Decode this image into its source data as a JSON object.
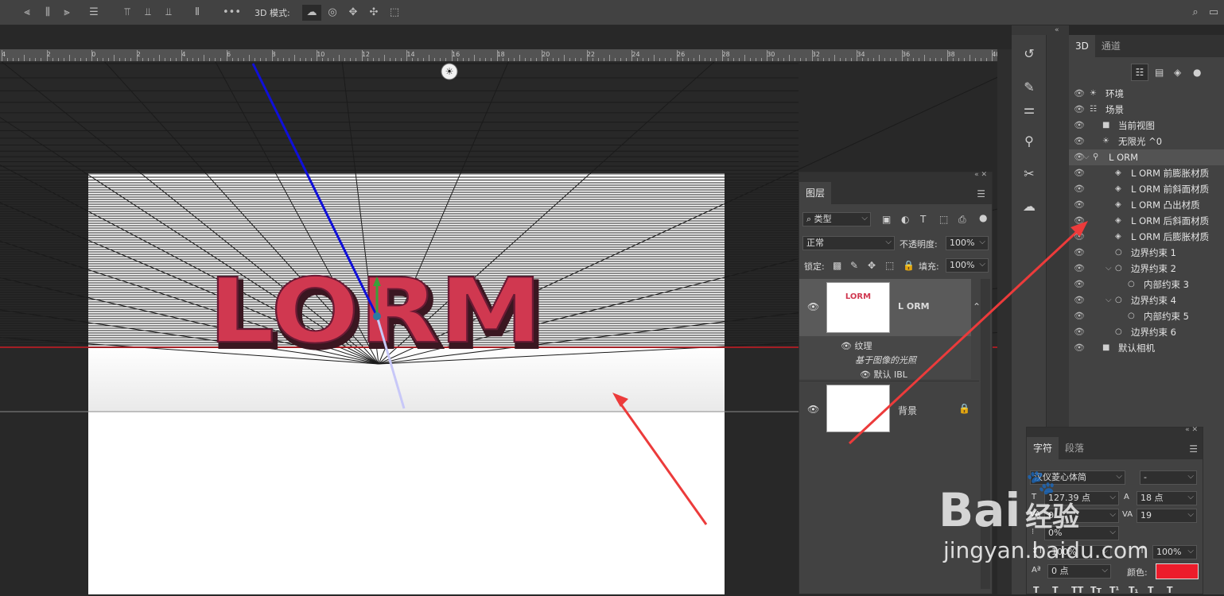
{
  "optionsbar": {
    "mode3d_label": "3D 模式:"
  },
  "ruler": {
    "labels": [
      "4",
      "2",
      "0",
      "2",
      "4",
      "6",
      "8",
      "10",
      "12",
      "14",
      "16",
      "18",
      "20",
      "22",
      "24",
      "26",
      "28",
      "30",
      "32",
      "34",
      "36",
      "38",
      "40"
    ]
  },
  "canvas": {
    "text3d": "LORM"
  },
  "panel3d": {
    "tabs": [
      "3D",
      "通道"
    ],
    "rows": [
      {
        "label": "环境"
      },
      {
        "label": "场景"
      },
      {
        "label": "当前视图"
      },
      {
        "label": "无限光 ^0"
      },
      {
        "label": "L ORM"
      },
      {
        "label": "L ORM 前膨胀材质"
      },
      {
        "label": "L ORM 前斜面材质"
      },
      {
        "label": "L ORM 凸出材质"
      },
      {
        "label": "L ORM 后斜面材质"
      },
      {
        "label": "L ORM 后膨胀材质"
      },
      {
        "label": "边界约束 1"
      },
      {
        "label": "边界约束 2"
      },
      {
        "label": "内部约束 3"
      },
      {
        "label": "边界约束 4"
      },
      {
        "label": "内部约束 5"
      },
      {
        "label": "边界约束 6"
      },
      {
        "label": "默认相机"
      }
    ]
  },
  "layers": {
    "tab": "图层",
    "filter": "类型",
    "blend": "正常",
    "opacity_label": "不透明度:",
    "opacity": "100%",
    "lock_label": "锁定:",
    "fill_label": "填充:",
    "fill": "100%",
    "layer1_name": "L ORM",
    "thumb_text": "LORM",
    "texture_label": "纹理",
    "ibl_label": "基于图像的光照",
    "default_ibl": "默认 IBL",
    "bg_name": "背景"
  },
  "character": {
    "tabs": [
      "字符",
      "段落"
    ],
    "font": "汉仪菱心体简",
    "style": "-",
    "size": "127.39 点",
    "leading": "18 点",
    "kerning": "0",
    "tracking": "19",
    "vscale_pct": "0%",
    "hscale": "100%",
    "vscale": "100%",
    "baseline": "0 点",
    "color_label": "颜色:",
    "color": "#ec1c2b",
    "style_buttons": [
      "T",
      "T",
      "TT",
      "Tт",
      "T¹",
      "T₁",
      "T",
      "T"
    ]
  },
  "watermark": {
    "logo": "Bai",
    "logo_cn": "经验",
    "url": "jingyan.baidu.com"
  }
}
